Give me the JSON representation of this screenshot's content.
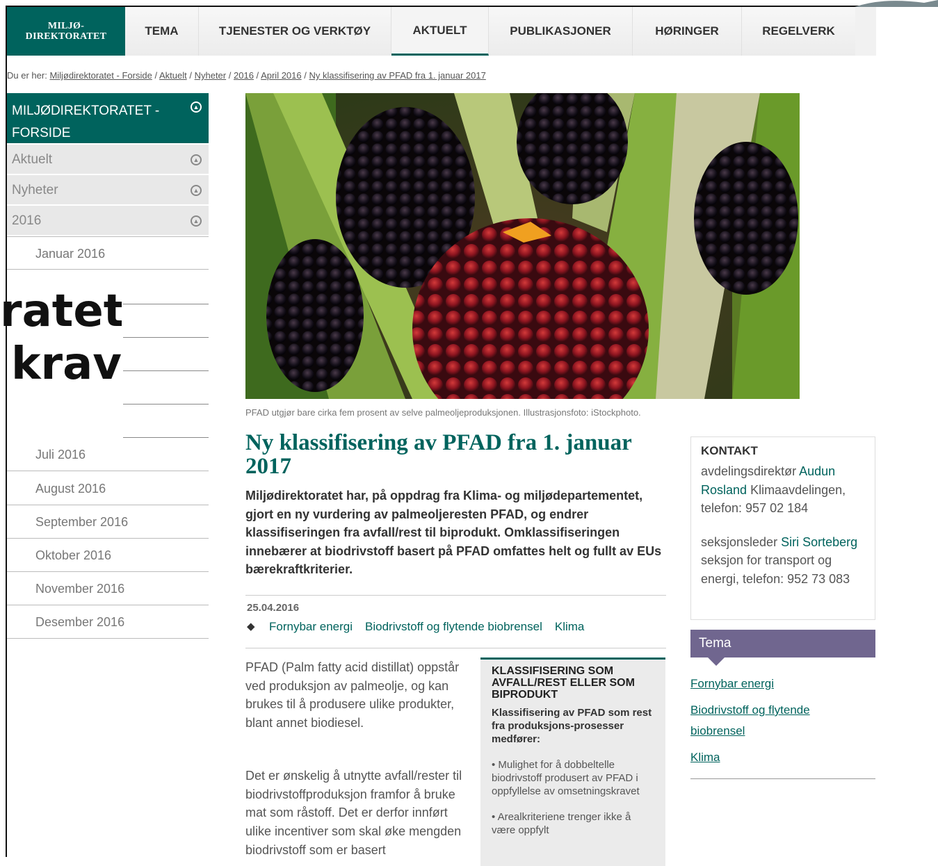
{
  "logo": {
    "line1": "MILJØ-",
    "line2": "DIREKTORATET"
  },
  "nav": {
    "items": [
      {
        "label": "TEMA",
        "active": false
      },
      {
        "label": "TJENESTER OG VERKTØY",
        "active": false
      },
      {
        "label": "AKTUELT",
        "active": true
      },
      {
        "label": "PUBLIKASJONER",
        "active": false
      },
      {
        "label": "HØRINGER",
        "active": false
      },
      {
        "label": "REGELVERK",
        "active": false
      }
    ]
  },
  "breadcrumb": {
    "prefix": "Du er her:",
    "items": [
      "Miljødirektoratet - Forside",
      "Aktuelt",
      "Nyheter",
      "2016",
      "April 2016",
      "Ny klassifisering av PFAD fra 1. januar 2017"
    ],
    "separator": "/"
  },
  "sidebar": {
    "home": "MILJØDIREKTORATET - FORSIDE",
    "sections": [
      "Aktuelt",
      "Nyheter",
      "2016"
    ],
    "months_top": [
      "Januar 2016"
    ],
    "months_bottom": [
      "Juli 2016",
      "August 2016",
      "September 2016",
      "Oktober 2016",
      "November 2016",
      "Desember 2016"
    ]
  },
  "overlay": {
    "line1": "ratet",
    "line2": "krav"
  },
  "hero": {
    "caption": "PFAD utgjør bare cirka fem prosent av selve palmeoljeproduksjonen. Illustrasjonsfoto: iStockphoto."
  },
  "article": {
    "title": "Ny klassifisering av PFAD fra 1. januar 2017",
    "lead": "Miljødirektoratet har, på oppdrag fra Klima- og miljødepartementet, gjort en ny vurdering av palmeoljeresten PFAD, og endrer klassifiseringen fra avfall/rest til biprodukt. Omklassifiseringen innebærer at biodrivstoff basert på PFAD omfattes helt og fullt av EUs bærekraftkriterier.",
    "date": "25.04.2016",
    "tags": [
      "Fornybar energi",
      "Biodrivstoff og flytende biobrensel",
      "Klima"
    ],
    "para1": "PFAD (Palm fatty acid distillat) oppstår ved produksjon av palmeolje, og kan brukes til å produsere ulike produkter, blant annet biodiesel.",
    "para2": "Det er ønskelig å utnytte avfall/rester til biodrivstoffproduksjon framfor å bruke mat som råstoff. Det er derfor innført ulike incentiver som skal øke mengden biodrivstoff som er basert"
  },
  "factbox": {
    "title": "KLASSIFISERING SOM AVFALL/REST ELLER SOM BIPRODUKT",
    "subtitle": "Klassifisering av PFAD som rest fra produksjons-prosesser medfører:",
    "items": [
      "• Mulighet for å dobbeltelle biodrivstoff produsert av PFAD i oppfyllelse av omsetningskravet",
      "• Arealkriteriene trenger ikke å være oppfylt"
    ]
  },
  "contact": {
    "heading": "KONTAKT",
    "c1_role": "avdelingsdirektør",
    "c1_name": "Audun Rosland",
    "c1_rest": "Klimaavdelingen, telefon: 957 02 184",
    "c2_role": "seksjonsleder",
    "c2_name": "Siri Sorteberg",
    "c2_rest": "seksjon for transport og energi, telefon: 952 73 083"
  },
  "tema": {
    "heading": "Tema",
    "links": [
      "Fornybar energi",
      "Biodrivstoff og flytende biobrensel",
      "Klima"
    ]
  },
  "colors": {
    "brand": "#00635d",
    "tema": "#70668f"
  }
}
